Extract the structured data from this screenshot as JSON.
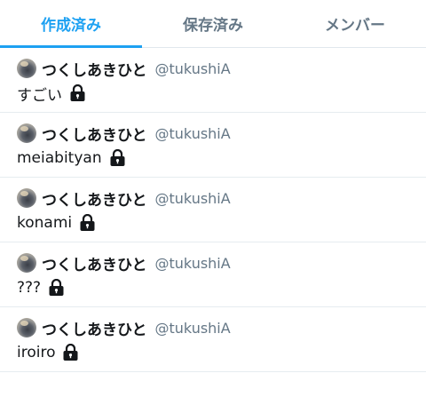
{
  "tabs": [
    {
      "label": "作成済み",
      "active": true
    },
    {
      "label": "保存済み",
      "active": false
    },
    {
      "label": "メンバー",
      "active": false
    }
  ],
  "lists": [
    {
      "owner_name": "つくしあきひと",
      "owner_handle": "@tukushiA",
      "name": "すごい",
      "icon": "lock-icon"
    },
    {
      "owner_name": "つくしあきひと",
      "owner_handle": "@tukushiA",
      "name": "meiabityan",
      "icon": "lock-icon"
    },
    {
      "owner_name": "つくしあきひと",
      "owner_handle": "@tukushiA",
      "name": "konami",
      "icon": "lock-icon"
    },
    {
      "owner_name": "つくしあきひと",
      "owner_handle": "@tukushiA",
      "name": "???",
      "icon": "lock-icon"
    },
    {
      "owner_name": "つくしあきひと",
      "owner_handle": "@tukushiA",
      "name": "iroiro",
      "icon": "lock-icon"
    }
  ],
  "colors": {
    "accent": "#1da1f2",
    "tab_inactive": "#657786",
    "divider": "#e6ecf0"
  }
}
